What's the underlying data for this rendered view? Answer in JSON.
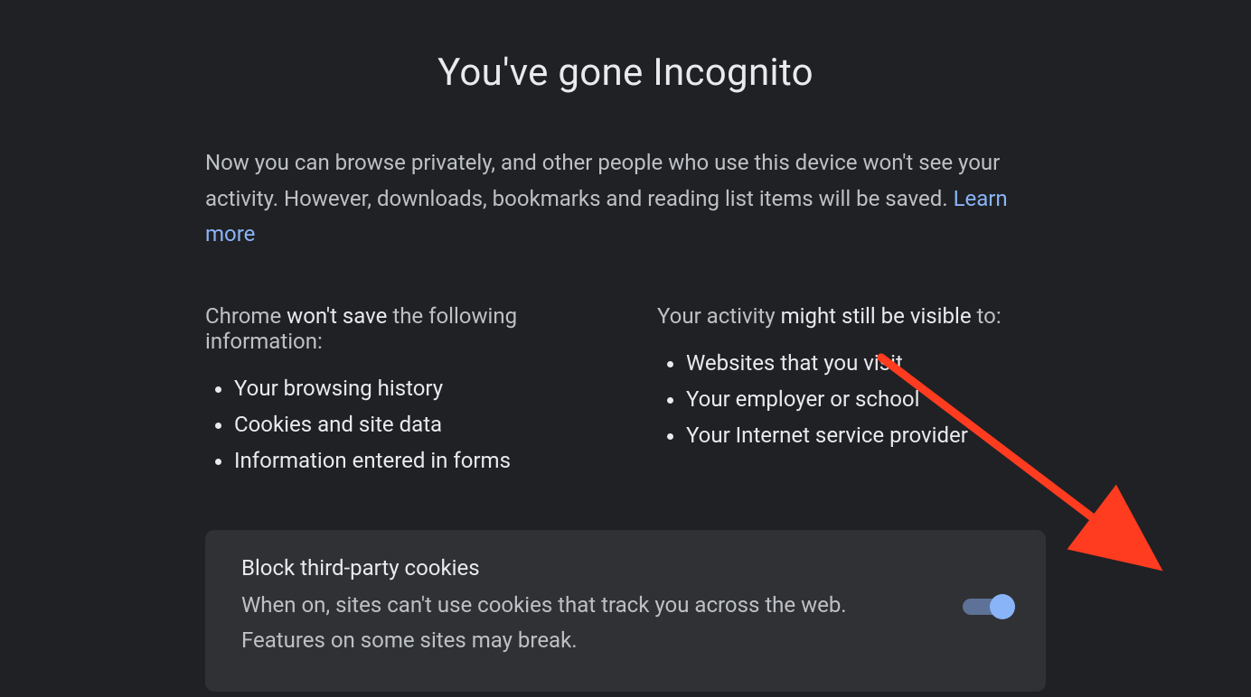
{
  "title": "You've gone Incognito",
  "intro": {
    "text_before_link": "Now you can browse privately, and other people who use this device won't see your activity. However, downloads, bookmarks and reading list items will be saved. ",
    "link_text": "Learn more"
  },
  "left": {
    "heading_pre": "Chrome ",
    "heading_strong": "won't save",
    "heading_post": " the following information:",
    "items": [
      "Your browsing history",
      "Cookies and site data",
      "Information entered in forms"
    ]
  },
  "right": {
    "heading_pre": "Your activity ",
    "heading_strong": "might still be visible",
    "heading_post": " to:",
    "items": [
      "Websites that you visit",
      "Your employer or school",
      "Your Internet service provider"
    ]
  },
  "card": {
    "title": "Block third-party cookies",
    "desc": "When on, sites can't use cookies that track you across the web. Features on some sites may break.",
    "toggle_on": true
  }
}
